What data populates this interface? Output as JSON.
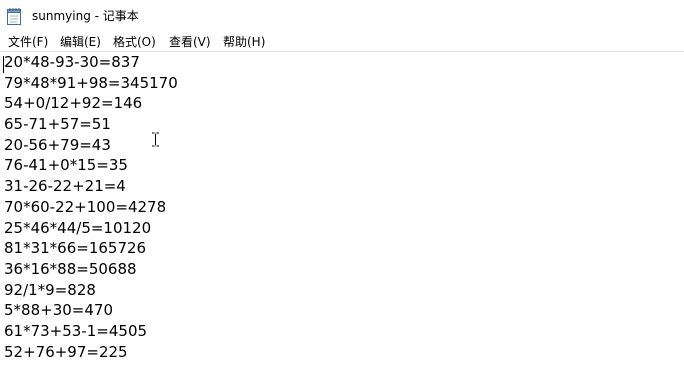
{
  "window": {
    "title": "sunmying - 记事本"
  },
  "menu": {
    "file": "文件(F)",
    "edit": "编辑(E)",
    "format": "格式(O)",
    "view": "查看(V)",
    "help": "帮助(H)"
  },
  "editor": {
    "lines": [
      "20*48-93-30=837",
      "79*48*91+98=345170",
      "54+0/12+92=146",
      "65-71+57=51",
      "20-56+79=43",
      "76-41+0*15=35",
      "31-26-22+21=4",
      "70*60-22+100=4278",
      "25*46*44/5=10120",
      "81*31*66=165726",
      "36*16*88=50688",
      "92/1*9=828",
      "5*88+30=470",
      "61*73+53-1=4505",
      "52+76+97=225"
    ]
  },
  "icons": {
    "app": "notepad-icon",
    "cursor": "text-cursor-icon"
  }
}
